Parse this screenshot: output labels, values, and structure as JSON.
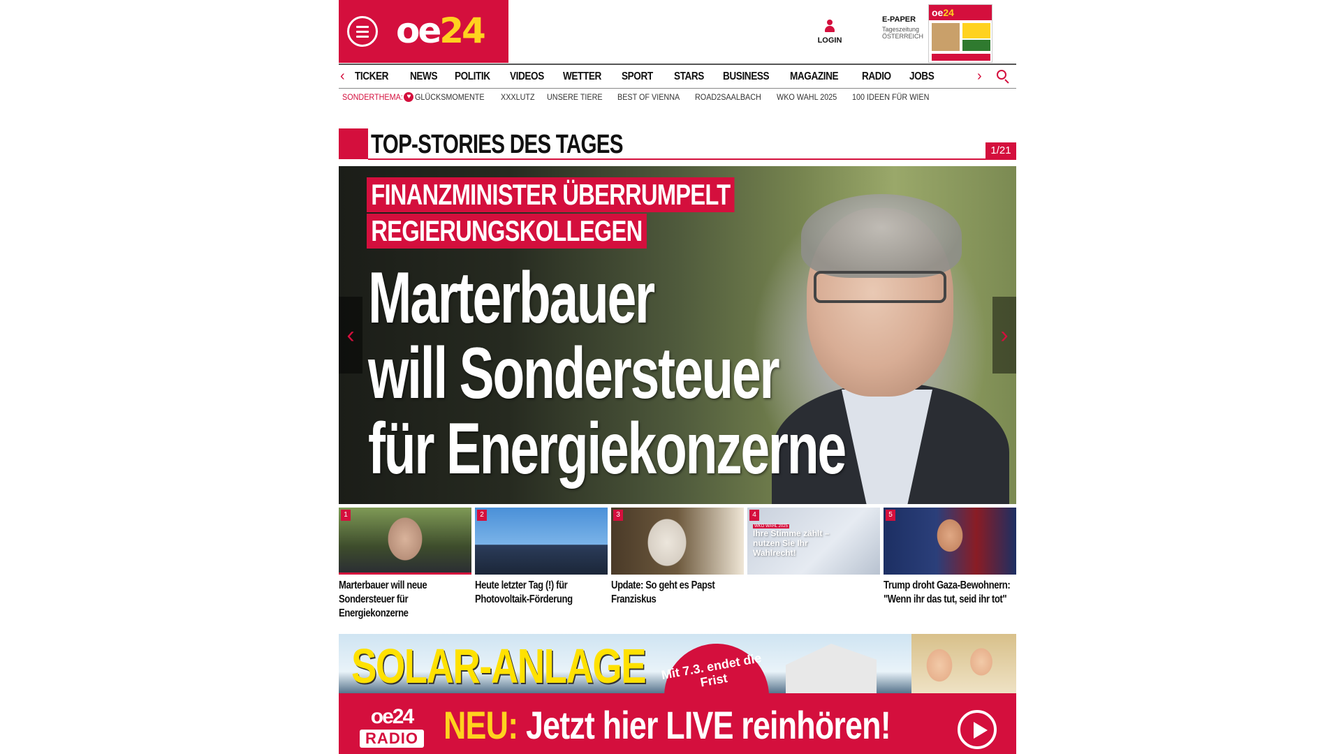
{
  "header": {
    "logo_oe": "oe",
    "logo_num": "24",
    "login_label": "LOGIN",
    "epaper_title": "E-PAPER",
    "epaper_sub1": "Tageszeitung",
    "epaper_sub2": "ÖSTERREICH"
  },
  "nav": {
    "items": [
      "TICKER",
      "NEWS",
      "POLITIK",
      "VIDEOS",
      "WETTER",
      "SPORT",
      "STARS",
      "BUSINESS",
      "MAGAZINE",
      "RADIO",
      "JOBS"
    ]
  },
  "subnav": {
    "label": "SONDERTHEMA:",
    "items": [
      "GLÜCKSMOMENTE",
      "XXXLUTZ",
      "UNSERE TIERE",
      "BEST OF VIENNA",
      "ROAD2SAALBACH",
      "WKO WAHL 2025",
      "100 IDEEN FÜR WIEN"
    ]
  },
  "section": {
    "title": "TOP-STORIES DES TAGES",
    "counter": "1/21"
  },
  "hero": {
    "kicker_line1": "FINANZMINISTER ÜBERRUMPELT",
    "kicker_line2": "REGIERUNGSKOLLEGEN",
    "headline_line1": "Marterbauer",
    "headline_line2": "will Sondersteuer",
    "headline_line3": "für Energiekonzerne"
  },
  "teasers": [
    {
      "num": "1",
      "title": "Marterbauer will neue Sondersteuer für Energiekonzerne"
    },
    {
      "num": "2",
      "title": "Heute letzter Tag (!) für Photovoltaik-Förderung"
    },
    {
      "num": "3",
      "title": "Update: So geht es Papst Franziskus"
    },
    {
      "num": "4",
      "title": "",
      "image_tag": "WKO WAHL 2025",
      "image_text": "Ihre Stimme zählt – nutzen Sie Ihr Wahlrecht!"
    },
    {
      "num": "5",
      "title": "Trump droht Gaza-Bewohnern: \"Wenn ihr das tut, seid ihr tot\""
    }
  ],
  "ad": {
    "title": "SOLAR-ANLAGE",
    "badge": "Mit 7.3. endet die Frist"
  },
  "radio": {
    "logo_oe": "oe24",
    "logo_radio": "RADIO",
    "neu": "NEU:",
    "rest": "Jetzt hier LIVE reinhören!"
  },
  "colors": {
    "brand_red": "#d40f3d",
    "brand_yellow": "#ffd21f"
  },
  "icons": [
    "menu-icon",
    "user-icon",
    "search-icon",
    "chevron-left-icon",
    "chevron-right-icon",
    "heart-icon",
    "play-icon"
  ]
}
